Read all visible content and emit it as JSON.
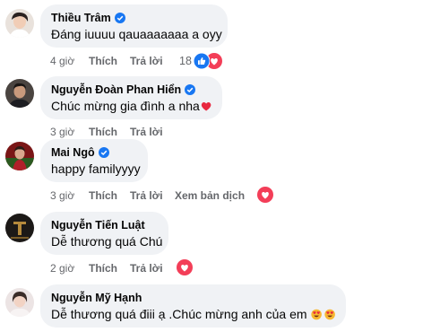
{
  "comments": [
    {
      "author": "Thiều Trâm",
      "verified": true,
      "text": "Đáng iuuuu qauaaaaaaa a oyy",
      "time": "4 giờ",
      "like": "Thích",
      "reply": "Trả lời",
      "reaction_count": "18",
      "reactions": [
        "like-icon",
        "love-icon"
      ]
    },
    {
      "author": "Nguyễn Đoàn Phan Hiển",
      "verified": true,
      "text": "Chúc mừng gia đình a nha",
      "text_emoji": "red-heart-emoji",
      "time": "3 giờ",
      "like": "Thích",
      "reply": "Trả lời"
    },
    {
      "author": "Mai Ngô",
      "verified": true,
      "text": "happy familyyyy",
      "time": "3 giờ",
      "like": "Thích",
      "reply": "Trả lời",
      "translate": "Xem bản dịch",
      "reactions": [
        "love-icon"
      ]
    },
    {
      "author": "Nguyễn Tiến Luật",
      "verified": false,
      "text": "Dễ thương quá Chú",
      "time": "2 giờ",
      "like": "Thích",
      "reply": "Trả lời",
      "reactions": [
        "love-icon"
      ]
    },
    {
      "author": "Nguyễn Mỹ Hạnh",
      "verified": false,
      "text": "Dễ thương quá điii ạ .Chúc mừng anh của em",
      "text_emoji": "heart-eyes-emoji"
    }
  ],
  "colors": {
    "bubble": "#f0f2f5",
    "meta_text": "#65676b",
    "verified_blue": "#1877f2",
    "love_red": "#f33e58"
  }
}
